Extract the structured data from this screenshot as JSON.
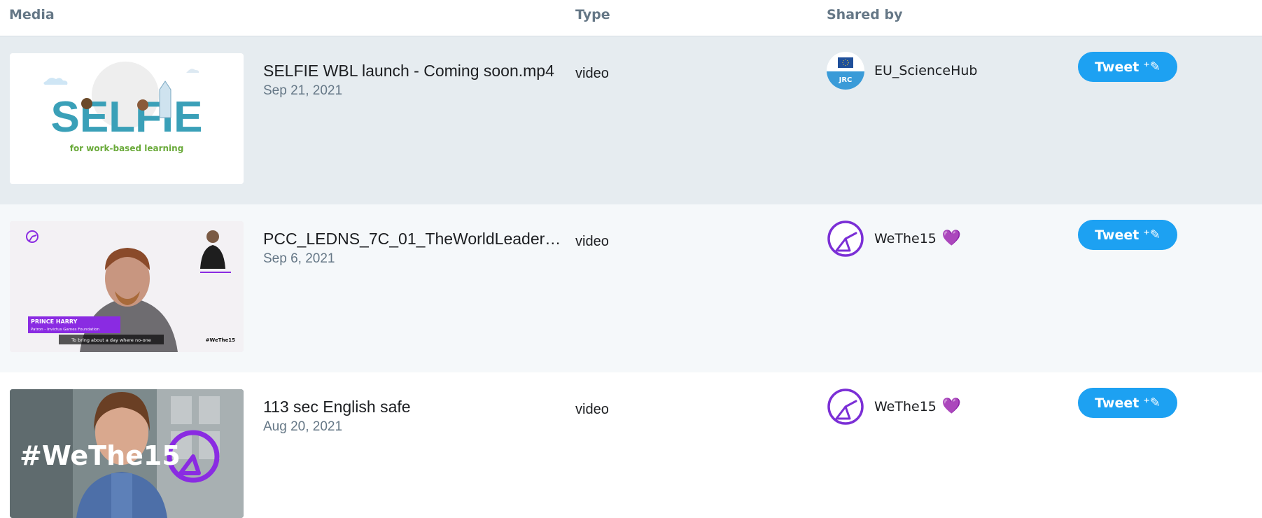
{
  "header": {
    "media": "Media",
    "type": "Type",
    "shared_by": "Shared by"
  },
  "rows": [
    {
      "thumb_word": "SELFIE",
      "thumb_sub": "for work-based learning",
      "title": "SELFIE WBL launch - Coming soon.mp4",
      "date": "Sep 21, 2021",
      "type": "video",
      "avatar_text": "JRC",
      "handle": "EU_ScienceHub",
      "tweet": "Tweet"
    },
    {
      "thumb_name": "PRINCE HARRY",
      "thumb_role": "Patron - Invictus Games Foundation",
      "thumb_caption": "To bring about a day where no-one",
      "thumb_tag": "#WeThe15",
      "title": "PCC_LEDNS_7C_01_TheWorldLeader…",
      "date": "Sep 6, 2021",
      "type": "video",
      "handle": "WeThe15",
      "heart": "💜",
      "tweet": "Tweet"
    },
    {
      "thumb_tag": "#WeThe15",
      "title": "113 sec English safe",
      "date": "Aug 20, 2021",
      "type": "video",
      "handle": "WeThe15",
      "heart": "💜",
      "tweet": "Tweet"
    }
  ],
  "colors": {
    "accent": "#1da1f2",
    "purple": "#7b4fe0"
  },
  "icons": {
    "tweet_button": "quill-icon",
    "avatar_wethe15": "wethe15-logo-icon"
  }
}
